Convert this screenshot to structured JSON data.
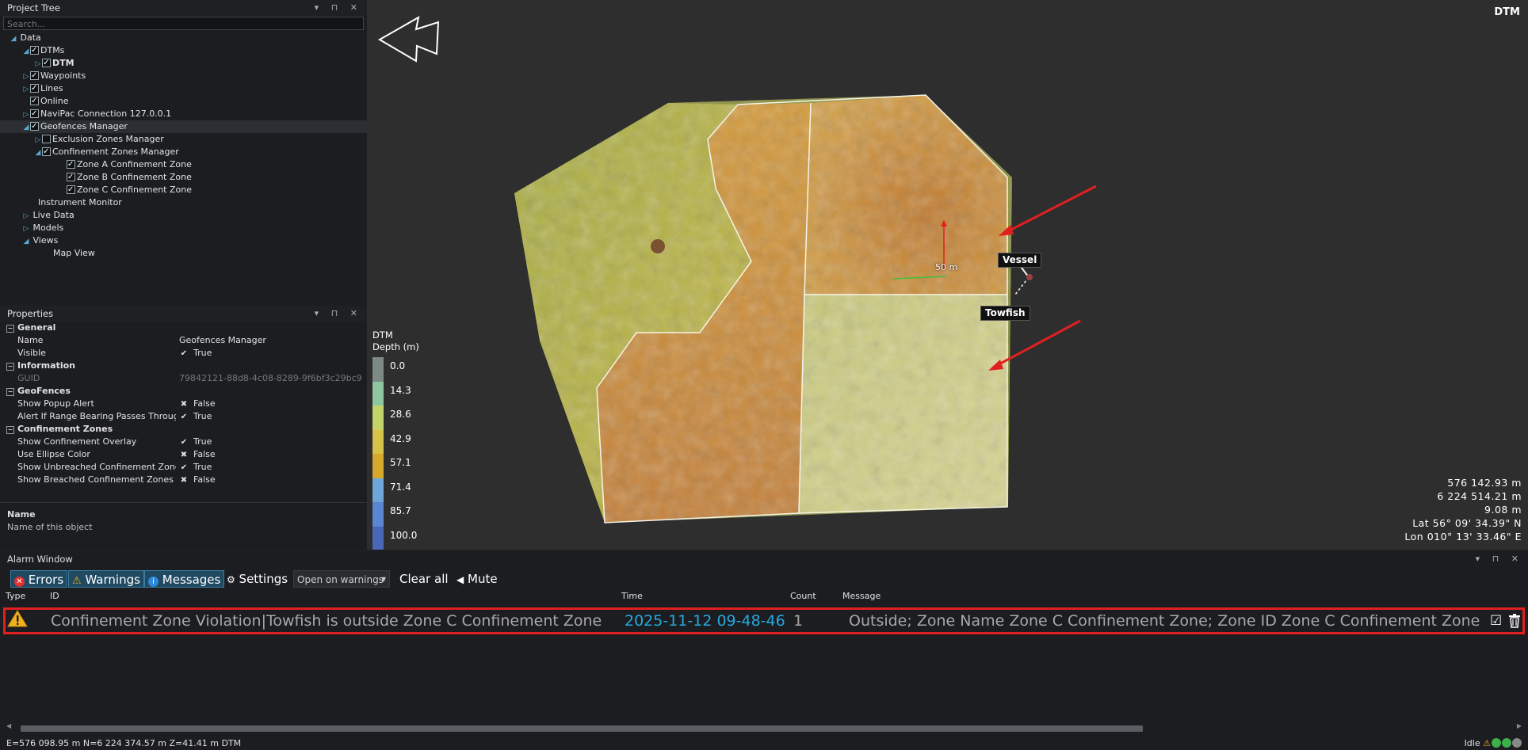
{
  "project_tree": {
    "title": "Project Tree",
    "search_placeholder": "Search...",
    "nodes": [
      {
        "label": "Data"
      },
      {
        "label": "DTMs"
      },
      {
        "label": "DTM"
      },
      {
        "label": "Waypoints"
      },
      {
        "label": "Lines"
      },
      {
        "label": "Online"
      },
      {
        "label": "NaviPac Connection 127.0.0.1"
      },
      {
        "label": "Geofences Manager"
      },
      {
        "label": "Exclusion Zones Manager"
      },
      {
        "label": "Confinement Zones Manager"
      },
      {
        "label": "Zone A Confinement Zone"
      },
      {
        "label": "Zone B Confinement Zone"
      },
      {
        "label": "Zone C Confinement Zone"
      },
      {
        "label": "Instrument Monitor"
      },
      {
        "label": "Live Data"
      },
      {
        "label": "Models"
      },
      {
        "label": "Views"
      },
      {
        "label": "Map View"
      }
    ]
  },
  "properties": {
    "title": "Properties",
    "rows": [
      {
        "name": "General"
      },
      {
        "name": "Name",
        "value": "Geofences Manager"
      },
      {
        "name": "Visible",
        "value": "True"
      },
      {
        "name": "Information"
      },
      {
        "name": "GUID",
        "value": "79842121-88d8-4c08-8289-9f6bf3c29bc9"
      },
      {
        "name": "GeoFences"
      },
      {
        "name": "Show Popup Alert",
        "value": "False"
      },
      {
        "name": "Alert If Range Bearing Passes Through E",
        "value": "True"
      },
      {
        "name": "Confinement Zones"
      },
      {
        "name": "Show Confinement Overlay",
        "value": "True"
      },
      {
        "name": "Use Ellipse Color",
        "value": "False"
      },
      {
        "name": "Show Unbreached Confinement Zones",
        "value": "True"
      },
      {
        "name": "Show Breached Confinement Zones in Se",
        "value": "False"
      }
    ],
    "description_title": "Name",
    "description_text": "Name of this object"
  },
  "map": {
    "view_label": "DTM",
    "legend_title": "DTM",
    "legend_subtitle": "Depth (m)",
    "legend": [
      {
        "label": "0.0",
        "color": "#7e8a86"
      },
      {
        "label": "14.3",
        "color": "#8fc6a2"
      },
      {
        "label": "28.6",
        "color": "#c4d46a"
      },
      {
        "label": "42.9",
        "color": "#d7c24a"
      },
      {
        "label": "57.1",
        "color": "#d6a92e"
      },
      {
        "label": "71.4",
        "color": "#6ea6d9"
      },
      {
        "label": "85.7",
        "color": "#5b86d2"
      },
      {
        "label": "100.0",
        "color": "#4a66b8"
      }
    ],
    "scale_label": "50 m",
    "vessel_label": "Vessel",
    "towfish_label": "Towfish",
    "coords": {
      "easting": "576 142.93 m",
      "northing": "6 224 514.21 m",
      "height": "9.08 m",
      "lat": "Lat 56° 09' 34.39\" N",
      "lon": "Lon 010° 13' 33.46\" E"
    }
  },
  "alarm_window": {
    "title": "Alarm Window",
    "toolbar": {
      "errors": "Errors",
      "warnings": "Warnings",
      "messages": "Messages",
      "settings": "Settings",
      "open_mode": "Open on warnings",
      "clear_all": "Clear all",
      "mute": "Mute"
    },
    "columns": {
      "type": "Type",
      "id": "ID",
      "time": "Time",
      "count": "Count",
      "message": "Message"
    },
    "rows": [
      {
        "id": "Confinement Zone Violation|Towfish is outside Zone C Confinement Zone",
        "time": "2025-11-12 09-48-46",
        "count": "1",
        "message": "Outside; Zone Name Zone C Confinement Zone; Zone ID Zone C Confinement Zone"
      }
    ]
  },
  "status_bar": {
    "position": "E=576 098.95 m N=6 224 374.57 m Z=41.41 m DTM",
    "state": "Idle"
  },
  "colors": {
    "alert_red": "#e02020",
    "time_blue": "#28a8e0",
    "selected_blue": "#1f4a62"
  }
}
